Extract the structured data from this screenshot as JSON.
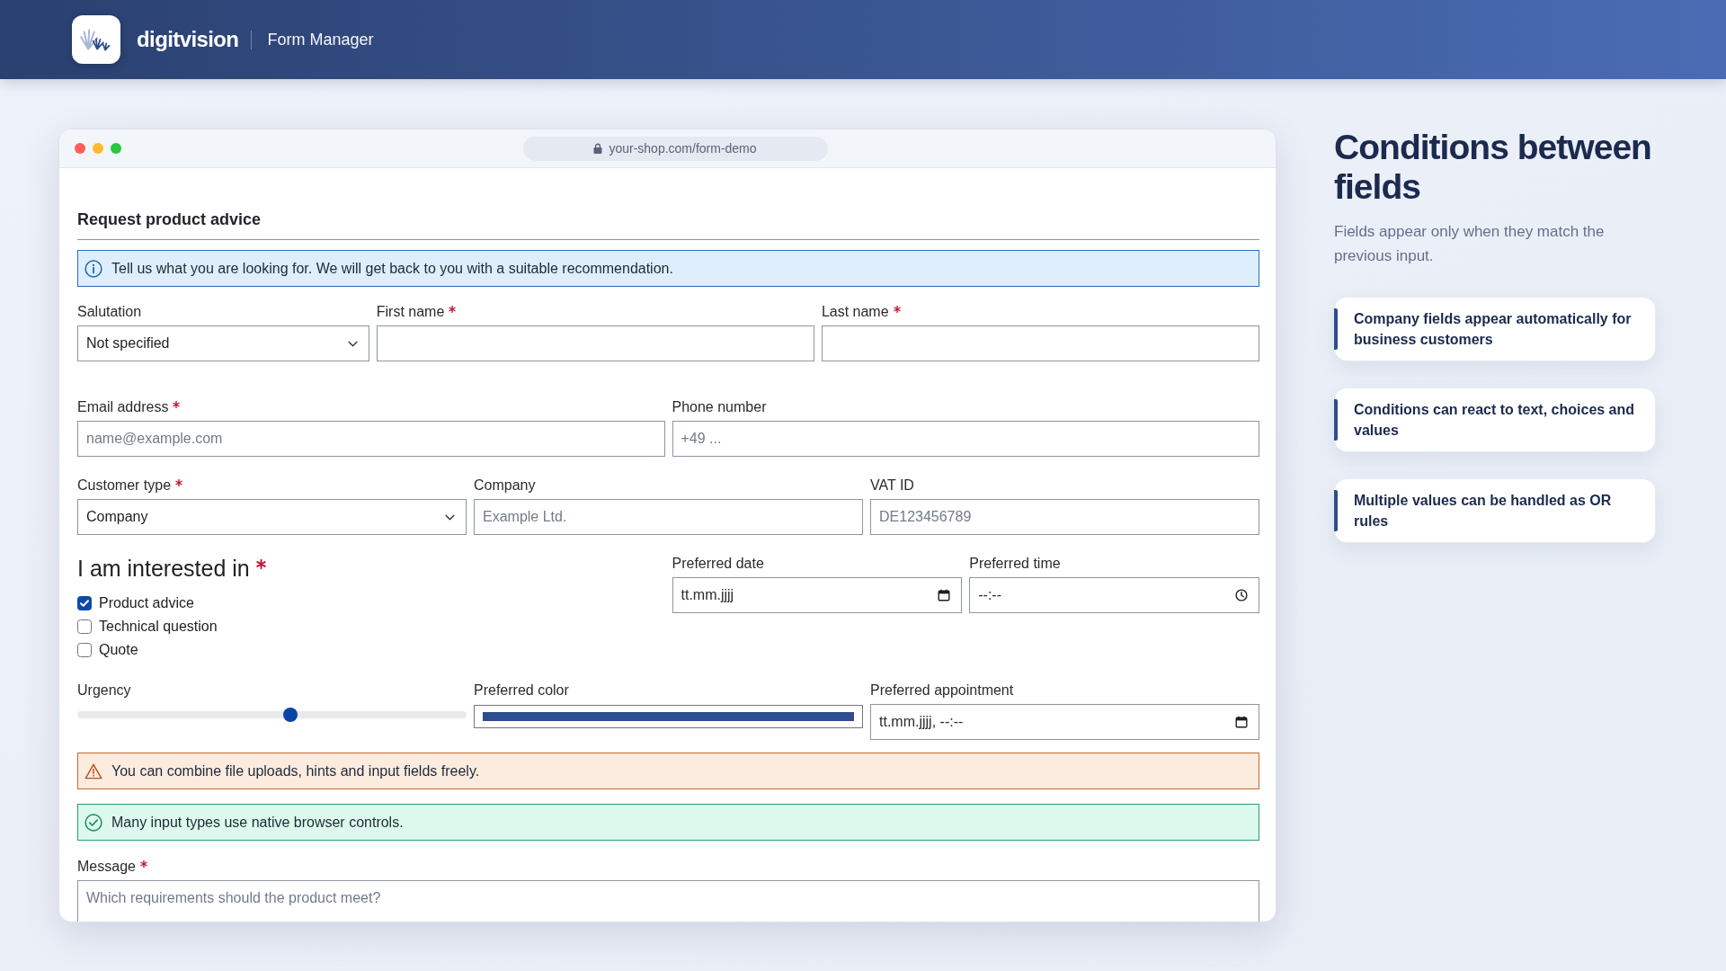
{
  "header": {
    "brand": "digitvision",
    "product": "Form Manager"
  },
  "browser": {
    "url": "your-shop.com/form-demo"
  },
  "form": {
    "title": "Request product advice",
    "blocks": [
      {
        "kind": "info",
        "text": "Tell us what you are looking for. We will get back to you with a suitable recommendation."
      },
      {
        "kind": "row",
        "fields": [
          {
            "kind": "select",
            "label": "Salutation",
            "required": false,
            "value": "Not specified"
          },
          {
            "kind": "text",
            "label": "First name",
            "required": true
          },
          {
            "kind": "text",
            "label": "Last name",
            "required": true
          }
        ]
      },
      {
        "kind": "row",
        "fields": [
          {
            "kind": "text",
            "label": "Email address",
            "required": true,
            "placeholder": "name@example.com"
          },
          {
            "kind": "text",
            "label": "Phone number",
            "required": false,
            "placeholder": "+49 ..."
          }
        ]
      },
      {
        "kind": "row",
        "fields": [
          {
            "kind": "select",
            "label": "Customer type",
            "required": true,
            "value": "Company"
          },
          {
            "kind": "text",
            "label": "Company",
            "required": false,
            "placeholder": "Example Ltd."
          },
          {
            "kind": "text",
            "label": "VAT ID",
            "required": false,
            "placeholder": "DE123456789"
          }
        ]
      },
      {
        "kind": "row",
        "fields": [
          {
            "kind": "checkbox_group",
            "label": "I am interested in",
            "required": true,
            "options": [
              {
                "label": "Product advice",
                "checked": true
              },
              {
                "label": "Technical question",
                "checked": false
              },
              {
                "label": "Quote",
                "checked": false
              }
            ]
          },
          {
            "kind": "date",
            "label": "Preferred date",
            "required": false,
            "placeholder": "tt.mm.jjjj"
          },
          {
            "kind": "time",
            "label": "Preferred time",
            "required": false,
            "placeholder": "--:--"
          }
        ]
      },
      {
        "kind": "row",
        "fields": [
          {
            "kind": "slider",
            "label": "Urgency",
            "required": false,
            "level": 0.55
          },
          {
            "kind": "color",
            "label": "Preferred color",
            "required": false,
            "color": "#2f4d8e"
          },
          {
            "kind": "datetime",
            "label": "Preferred appointment",
            "required": false,
            "placeholder": "tt.mm.jjjj, --:--"
          }
        ]
      },
      {
        "kind": "warning",
        "text": "You can combine file uploads, hints and input fields freely."
      },
      {
        "kind": "success",
        "text": "Many input types use native browser controls."
      },
      {
        "kind": "row",
        "fields": [
          {
            "kind": "textarea",
            "label": "Message",
            "required": true,
            "placeholder": "Which requirements should the product meet?"
          }
        ]
      }
    ]
  },
  "sidebar": {
    "title": "Conditions between fields",
    "subtitle": "Fields appear only when they match the previous input.",
    "cards": [
      {
        "text": "Company fields appear automatically for business customers"
      },
      {
        "text": "Conditions can react to text, choices and values"
      },
      {
        "text": "Multiple values can be handled as OR rules"
      }
    ]
  }
}
